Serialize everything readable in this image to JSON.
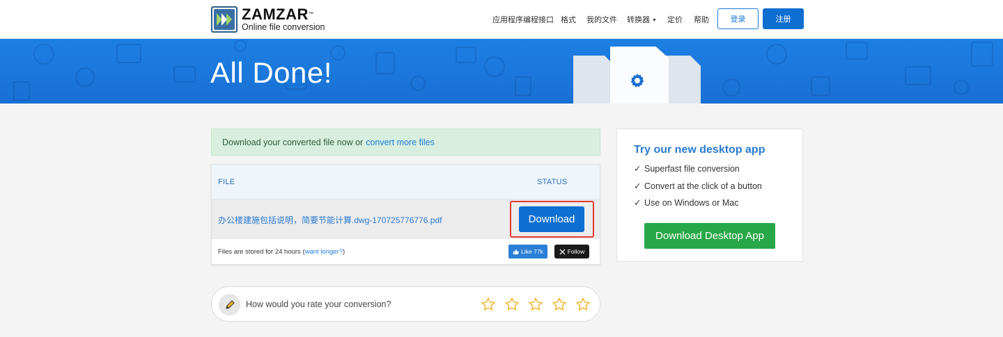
{
  "header": {
    "logo_name": "ZAMZAR",
    "logo_tm": "™",
    "logo_tagline": "Online file conversion",
    "nav": [
      {
        "label": "应用程序编程接口"
      },
      {
        "label": "格式"
      },
      {
        "label": "我的文件"
      },
      {
        "label": "转换器",
        "dropdown": true
      },
      {
        "label": "定价"
      },
      {
        "label": "帮助"
      }
    ],
    "login_label": "登录",
    "register_label": "注册"
  },
  "banner": {
    "title": "All Done!"
  },
  "alert": {
    "text": "Download your converted file now or",
    "link": "convert more files"
  },
  "files": {
    "col_file": "FILE",
    "col_status": "STATUS",
    "rows": [
      {
        "name": "办公楼建施包括说明，简要节能计算.dwg-170725776776.pdf",
        "action": "Download"
      }
    ],
    "store_note_prefix": "Files are stored for 24 hours (",
    "store_note_link": "want longer?",
    "store_note_suffix": ")",
    "like_label": "Like 77k",
    "follow_label": "Follow"
  },
  "rating": {
    "question": "How would you rate your conversion?",
    "stars": 5
  },
  "promo": {
    "title": "Try our new desktop app",
    "items": [
      "Superfast file conversion",
      "Convert at the click of a button",
      "Use on Windows or Mac"
    ],
    "button": "Download Desktop App"
  },
  "colors": {
    "brand_blue": "#0d6fd1",
    "banner_blue": "#1d7fe3",
    "success_green": "#27a747",
    "highlight_red": "#e03a2f",
    "star_gold": "#f2b42c"
  }
}
